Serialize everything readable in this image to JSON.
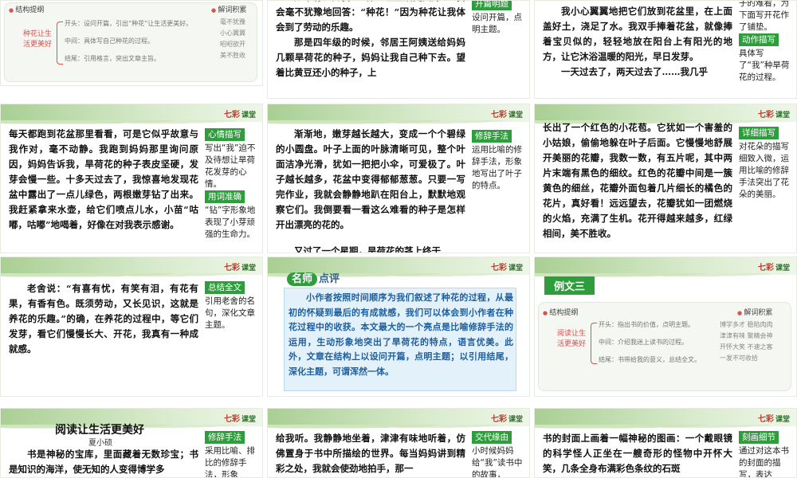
{
  "brand": {
    "logo": "七彩",
    "sub": "课堂"
  },
  "s1": {
    "outline_title": "结构提纲",
    "vocab_title": "解词积累",
    "center": "种花让生活更美好",
    "lines": [
      "开头：设问开篇，引出“种花”让生活更美好。",
      "中间：具体写自己种花的过程。",
      "结尾：引用格言，突出文章主旨。"
    ],
    "vocab": [
      "毫不犹豫",
      "小心翼翼",
      "昭昭欲开",
      "美不胜收"
    ]
  },
  "s2": {
    "paras": [
      "如果有人问我：“什么让生活更美好？”我会毫不犹豫地回答：“种花！”因为种花让我体会到了劳动的乐趣。",
      "那是四年级的时候，邻居王阿姨送给妈妈几颗旱荷花的种子，妈妈让我自己种下去。望着比黄豆还小的种子，上"
    ],
    "tag": "开篇明题",
    "note": "设问开篇，点明主题。"
  },
  "s3": {
    "paras": [
      "我小心翼翼地把它们放到花盆里，在上面盖好土，浇足了水。我双手捧着花盆，就像捧着宝贝似的，轻轻地放在阳台上有阳光的地方，让它沐浴温暖的阳光，早日发芽。",
      "一天过去了，两天过去了……我几乎"
    ],
    "note_top": "子的难看，为下面写开花作了铺垫。",
    "tag": "动作描写",
    "note": "具体写了“我”种旱荷花的过程。"
  },
  "s4": {
    "para": "每天都跑到花盆那里看看，可是它似乎故意与我作对，毫不动静。我跑到妈妈那里询问原因，妈妈告诉我，旱荷花的种子表皮坚硬，发芽会慢一些。十多天过去了，我惊喜地发现花盆中露出了一点儿绿色，两根嫩芽钻了出来。我赶紧拿来水壶，给它们喷点儿水，小苗“咕嘟，咕嘟”地喝着，好像在对我表示感谢。",
    "tag1": "心情描写",
    "note1": "写出“我”迫不及待想让旱荷花发芽的心情。",
    "tag2": "用词准确",
    "note2": "“钻”字形象地表现了小芽顽强的生命力。"
  },
  "s5": {
    "para": "渐渐地，嫩芽越长越大，变成一个个碧绿的小圆盘。叶子上面的叶脉清晰可见，整个叶面洁净光滑，犹如一把把小伞，可爱极了。叶子越长越多，花盆中变得郁郁葱葱。只要一写完作业，我就会静静地趴在阳台上，默默地观察它们。我倒要看一看这么难看的种子是怎样开出漂亮的花的。",
    "tail": "又过了一个星期，旱荷花的茎上终于",
    "tag": "修辞手法",
    "note": "运用比喻的修辞手法，形象地写出了叶子的特点。"
  },
  "s6": {
    "para": "长出了一个红色的小花苞。它犹如一个害羞的小姑娘，偷偷地躲在叶子后面。它慢慢地舒展开美丽的花瓣，我数一数，有五片呢，其中两片末端有黑色的细纹。红色的花瓣中间是一簇黄色的细丝，花瓣外面包着几片细长的橘色的花片，真好看！远远望去，花瓣犹如一团燃烧的火焰，充满了生机。花开得越来越多，红绿相间，美不胜收。",
    "tag": "详细描写",
    "note": "对花朵的描写细致入微，运用比喻的修辞手法突出了花朵的美丽。"
  },
  "s7": {
    "para": "老舍说：“有喜有忧，有笑有泪，有花有果，有香有色。既须劳动，又长见识，这就是养花的乐趣。”的确，在养花的过程中，等它们发芽，看它们慢慢长大、开花，我真有一种成就感。",
    "tag": "总结全文",
    "note": "引用老舍的名句，深化文章主题。"
  },
  "s8": {
    "title_a": "名师",
    "title_b": "点评",
    "para": "小作者按照时间顺序为我们叙述了种花的过程，从最初的怀疑到最后的有成就感，我们可以体会到小作者在种花过程中的收获。本文最大的一个亮点是比喻修辞手法的运用，生动形象地突出了旱荷花的特点，语言优美。此外，文章在结构上以设问开篇，点明主题；以引用结尾，深化主题，可谓浑然一体。"
  },
  "s9": {
    "badge": "例文三",
    "outline_title": "结构提纲",
    "vocab_title": "解词积累",
    "center": "阅读让生活更美好",
    "lines": [
      "开头：指出书的价值，点明主题。",
      "中间：介绍我迷上读书的过程。",
      "结尾：书带给我的意义，总结全文。"
    ],
    "vocab": [
      "博学多才",
      "稳陷肉肉",
      "津津有味",
      "聚精会神",
      "开怀大笑",
      "不速之客",
      "一发不可收拾"
    ]
  },
  "s10": {
    "title": "阅读让生活更美好",
    "author": "夏小硕",
    "para": "书是神秘的宝库，里面藏着无数珍宝；书是知识的海洋，使无知的人变得博学多",
    "tag": "修辞手法",
    "note": "采用比喻、排比的修辞手法，形象"
  },
  "s11": {
    "para": "给我听。我静静地坐着，津津有味地听着，仿佛置身于书中所描绘的世界。每当妈妈讲到精彩之处，我就会使劲地拍手，那一",
    "tag": "交代缘由",
    "note": "小时候妈妈给“我”读书中的故事，"
  },
  "s12": {
    "para": "书的封面上画着一幅神秘的图画：一个戴眼镜的科学怪人正坐在一艘奇形的怪物中开怀大笑，几条全身布满彩色条纹的石斑",
    "tag": "刻画细节",
    "note": "通过对这本书的封面的描写，表达"
  }
}
